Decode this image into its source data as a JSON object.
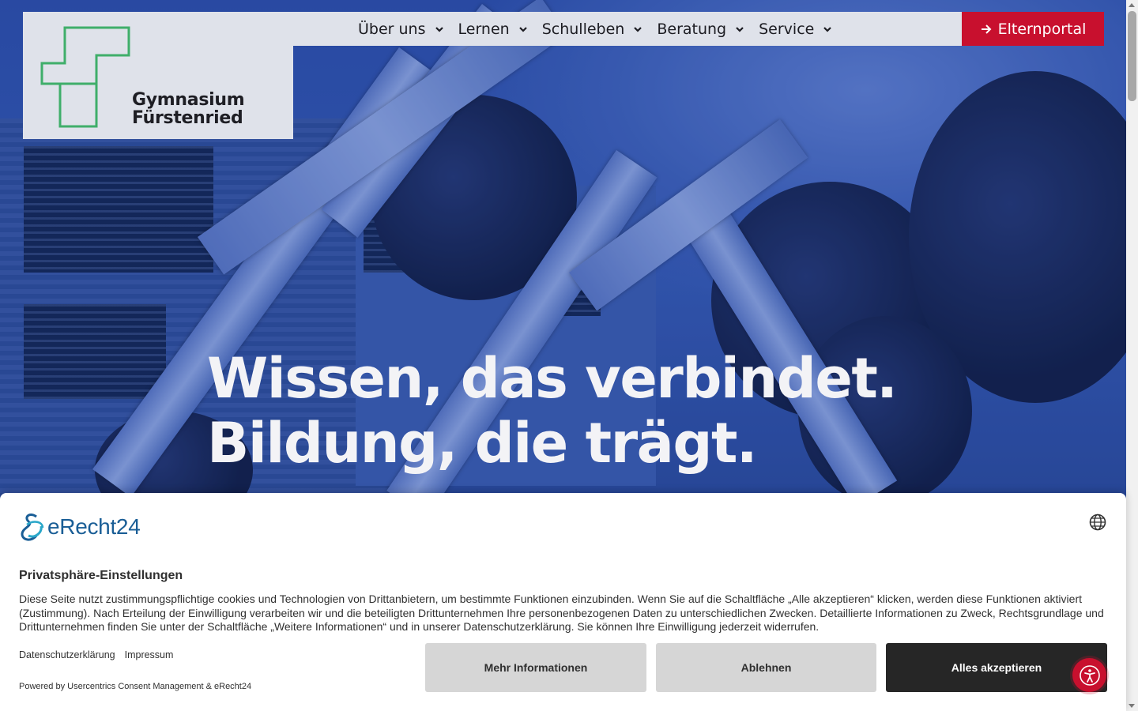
{
  "logo": {
    "line1": "Gymnasium",
    "line2": "Fürstenried",
    "mark_color": "#3fae6a"
  },
  "nav": {
    "items": [
      {
        "label": "Über uns"
      },
      {
        "label": "Lernen"
      },
      {
        "label": "Schulleben"
      },
      {
        "label": "Beratung"
      },
      {
        "label": "Service"
      }
    ],
    "portal_label": "Elternportal",
    "portal_color": "#c8102e"
  },
  "hero": {
    "line1": "Wissen, das verbindet.",
    "line2": "Bildung, die trägt."
  },
  "consent": {
    "brand": "eRecht24",
    "title": "Privatsphäre-Einstellungen",
    "text": "Diese Seite nutzt zustimmungspflichtige cookies und Technologien von Drittanbietern, um bestimmte Funktionen einzubinden. Wenn Sie auf die Schaltfläche „Alle akzeptieren“ klicken, werden diese Funktionen aktiviert (Zustimmung). Nach Erteilung der Einwilligung verarbeiten wir und die beteiligten Drittunternehmen Ihre personenbezogenen Daten zu unterschiedlichen Zwecken. Detaillierte Informationen zu Zweck, Rechtsgrundlage und Drittunternehmen finden Sie unter der Schaltfläche „Weitere Informationen“ und in unserer Datenschutzerklärung. Sie können Ihre Einwilligung jederzeit widerrufen.",
    "link_privacy": "Datenschutzerklärung",
    "link_imprint": "Impressum",
    "powered_by": "Powered by Usercentrics Consent Management & eRecht24",
    "btn_more": "Mehr Informationen",
    "btn_deny": "Ablehnen",
    "btn_accept": "Alles akzeptieren",
    "language_icon": "globe-icon",
    "accessibility_icon": "accessibility-icon"
  }
}
